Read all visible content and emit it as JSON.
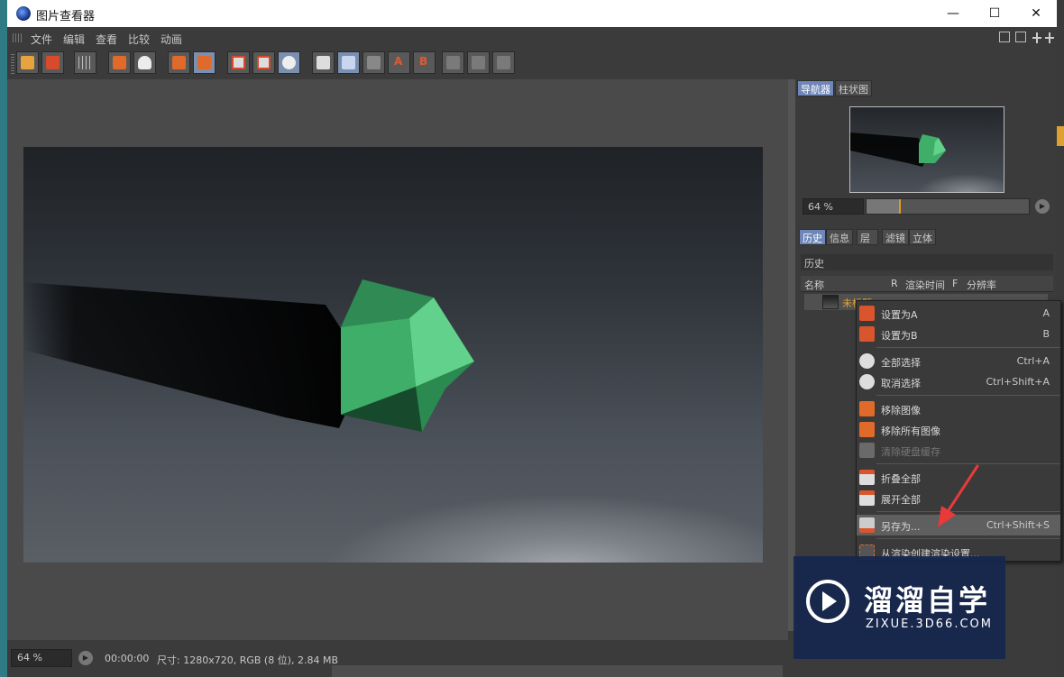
{
  "window": {
    "title": "图片查看器",
    "controls": {
      "minimize": "—",
      "maximize": "☐",
      "close": "✕"
    }
  },
  "menubar": {
    "items": [
      "文件",
      "编辑",
      "查看",
      "比较",
      "动画"
    ]
  },
  "toolbar": {
    "letter_a": "A",
    "letter_b": "B"
  },
  "navigator": {
    "tabs": [
      "导航器",
      "柱状图"
    ],
    "zoom": "64 %",
    "slider_fraction": 0.2
  },
  "history": {
    "tabs": [
      "历史",
      "信息",
      "层",
      "滤镜",
      "立体"
    ],
    "header": "历史",
    "columns": [
      "名称",
      "R",
      "渲染时间",
      "F",
      "分辨率"
    ],
    "row_name": "未标题"
  },
  "context_menu": {
    "items": [
      {
        "label": "设置为A",
        "shortcut": "A",
        "icon": "set-a-icon"
      },
      {
        "label": "设置为B",
        "shortcut": "B",
        "icon": "set-b-icon"
      },
      {
        "label": "全部选择",
        "shortcut": "Ctrl+A",
        "icon": "select-all-icon"
      },
      {
        "label": "取消选择",
        "shortcut": "Ctrl+Shift+A",
        "icon": "deselect-icon"
      },
      {
        "label": "移除图像",
        "shortcut": "",
        "icon": "remove-image-icon"
      },
      {
        "label": "移除所有图像",
        "shortcut": "",
        "icon": "remove-all-images-icon"
      },
      {
        "label": "清除硬盘缓存",
        "shortcut": "",
        "icon": "clear-cache-icon",
        "disabled": true
      },
      {
        "label": "折叠全部",
        "shortcut": "",
        "icon": "collapse-all-icon"
      },
      {
        "label": "展开全部",
        "shortcut": "",
        "icon": "expand-all-icon"
      },
      {
        "label": "另存为...",
        "shortcut": "Ctrl+Shift+S",
        "icon": "save-as-icon",
        "highlighted": true
      },
      {
        "label": "从渲染创建渲染设置...",
        "shortcut": "",
        "icon": "create-render-settings-icon"
      }
    ]
  },
  "statusbar": {
    "zoom": "64 %",
    "time": "00:00:00",
    "info": "尺寸: 1280x720, RGB (8 位), 2.84 MB"
  },
  "watermark": {
    "title": "溜溜自学",
    "url": "ZIXUE.3D66.COM"
  },
  "colors": {
    "accent": "#6e87b8",
    "toolbar_orange": "#e06a2a",
    "arrow_red": "#e83a3a",
    "gem_green": "#3fae68"
  }
}
